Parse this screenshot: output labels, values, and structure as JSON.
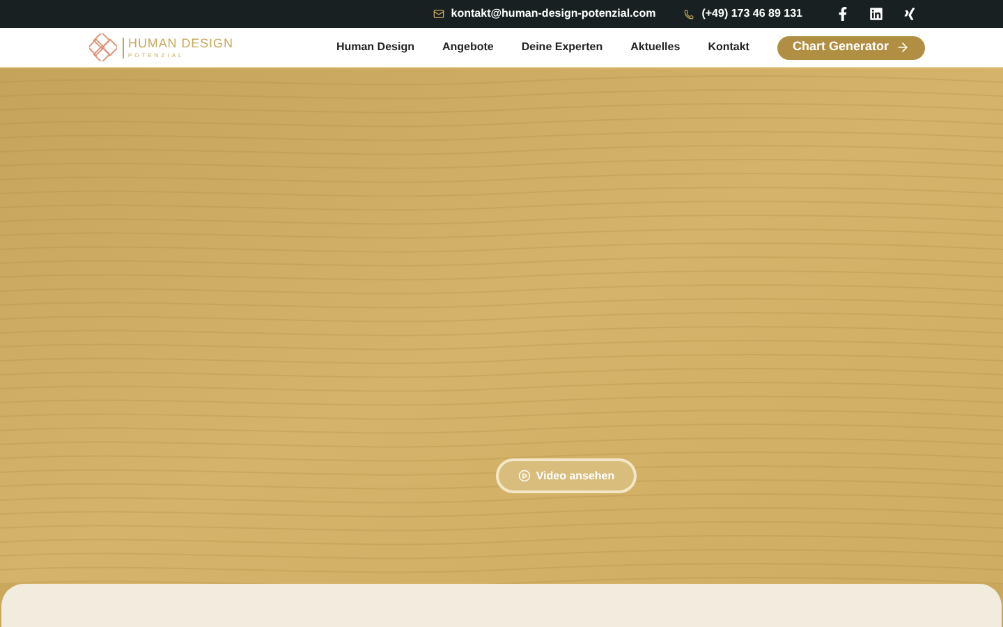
{
  "top_bar": {
    "email": "kontakt@human-design-potenzial.com",
    "phone": "(+49) 173 46 89 131"
  },
  "logo": {
    "title": "HUMAN DESIGN",
    "subtitle": "POTENZIAL"
  },
  "nav": {
    "items": [
      "Human Design",
      "Angebote",
      "Deine Experten",
      "Aktuelles",
      "Kontakt"
    ],
    "cta": "Chart Generator"
  },
  "hero": {
    "button": "Video ansehen"
  }
}
